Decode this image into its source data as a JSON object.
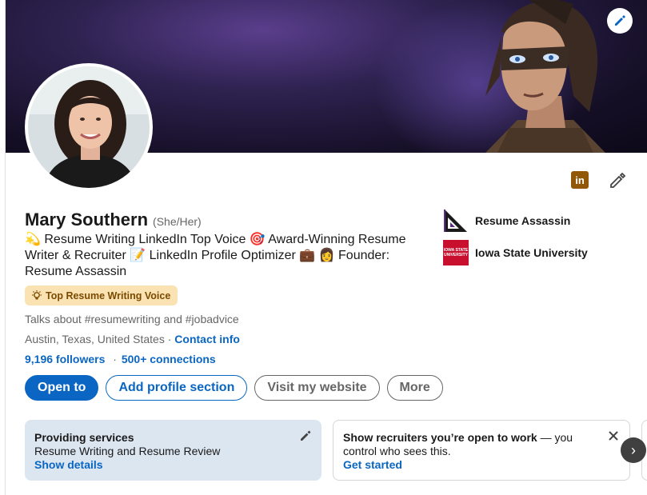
{
  "profile": {
    "name": "Mary Southern",
    "pronouns": "(She/Her)",
    "headline_parts": [
      "💫 Resume Writing LinkedIn Top Voice 🎯 Award-Winning Resume Writer & Recruiter 📝 LinkedIn Profile Optimizer 💼 👩 Founder: Resume Assassin"
    ],
    "badge": "Top Resume Writing Voice",
    "talks_about": "Talks about #resumewriting and #jobadvice",
    "location": "Austin, Texas, United States",
    "location_sep": " · ",
    "contact_info": "Contact info",
    "followers": "9,196 followers",
    "stats_sep": "·",
    "connections": "500+ connections"
  },
  "actions": {
    "open_to": "Open to",
    "add_section": "Add profile section",
    "visit_website": "Visit my website",
    "more": "More"
  },
  "orgs": [
    {
      "name": "Resume Assassin"
    },
    {
      "name": "Iowa State University",
      "logo_text": "IOWA STATE UNIVERSITY"
    }
  ],
  "services_card": {
    "title": "Providing services",
    "description": "Resume Writing and Resume Review",
    "link": "Show details"
  },
  "recruiters_card": {
    "title": "Show recruiters you’re open to work",
    "rest": " — you control who sees this.",
    "link": "Get started"
  },
  "icons": {
    "banner_edit": "pencil-icon",
    "linkedin": "linkedin-icon",
    "profile_edit": "pencil-icon",
    "badge": "lightbulb-icon",
    "close": "close-icon",
    "next": "chevron-right-icon"
  },
  "colors": {
    "brand_blue": "#0a66c2",
    "badge_bg": "#fbe2b2",
    "service_bg": "#dce6f1",
    "linkedin_icon": "#915907"
  }
}
